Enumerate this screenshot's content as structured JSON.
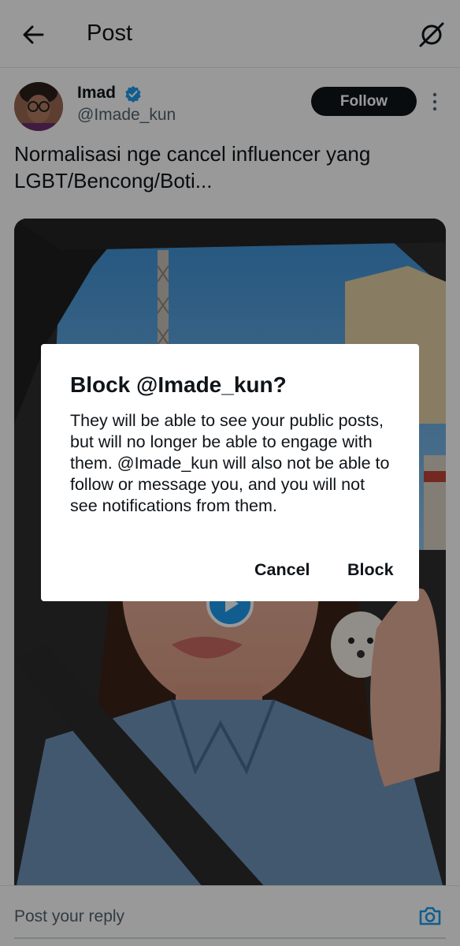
{
  "header": {
    "title": "Post",
    "back_icon": "arrow-left-icon",
    "grok_icon": "grok-icon"
  },
  "post": {
    "author_name": "Imad",
    "author_handle": "@Imade_kun",
    "verified": true,
    "follow_label": "Follow",
    "text": "Normalisasi nge cancel influencer yang LGBT/Bencong/Boti...",
    "media_type": "video"
  },
  "reply": {
    "placeholder": "Post your reply",
    "camera_icon": "camera-icon"
  },
  "dialog": {
    "title": "Block @Imade_kun?",
    "body": "They will be able to see your public posts, but will no longer be able to engage with them. @Imade_kun will also not be able to follow or message you, and you will not see notifications from them.",
    "cancel_label": "Cancel",
    "block_label": "Block"
  },
  "colors": {
    "accent": "#1d9bf0",
    "text": "#0f1419",
    "secondary": "#536471",
    "follow_bg": "#0f1419"
  }
}
